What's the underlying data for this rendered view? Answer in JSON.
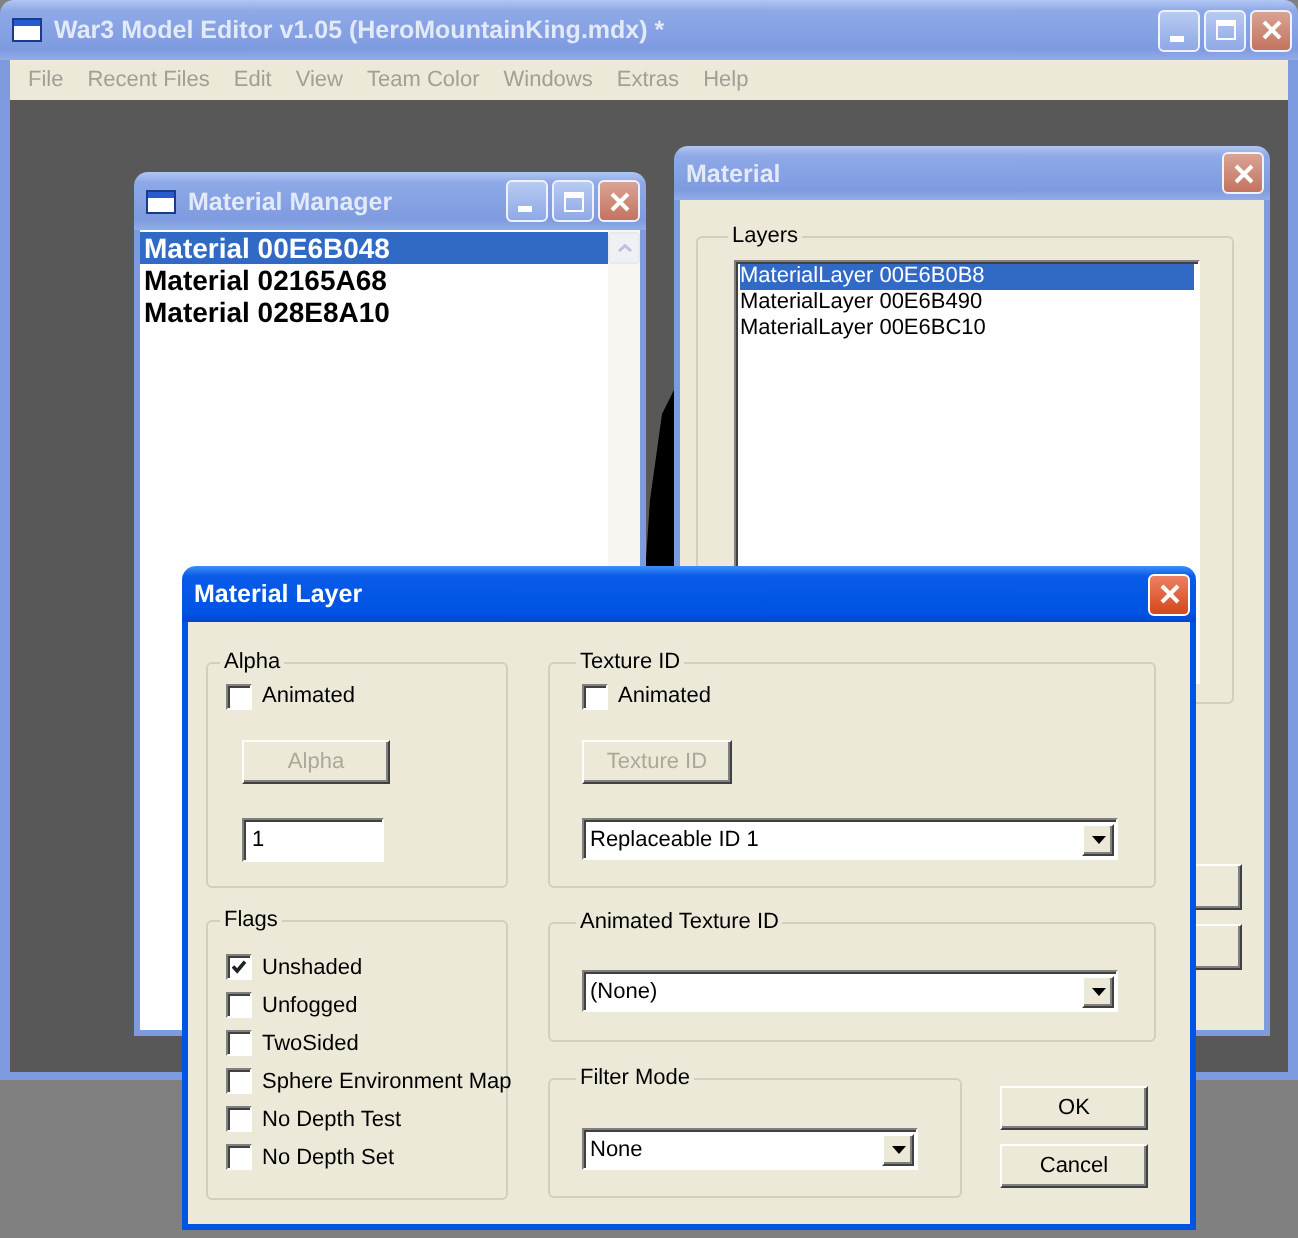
{
  "main_window": {
    "title": "War3 Model Editor v1.05 (HeroMountainKing.mdx) *",
    "active": false,
    "menu": [
      {
        "label": "File",
        "disabled": true
      },
      {
        "label": "Recent Files",
        "disabled": true
      },
      {
        "label": "Edit",
        "disabled": true
      },
      {
        "label": "View",
        "disabled": true
      },
      {
        "label": "Team Color",
        "disabled": true
      },
      {
        "label": "Windows",
        "disabled": true
      },
      {
        "label": "Extras",
        "disabled": true
      },
      {
        "label": "Help",
        "disabled": true
      }
    ]
  },
  "material_manager": {
    "title": "Material Manager",
    "active": false,
    "items": [
      {
        "label": "Material 00E6B048",
        "selected": true
      },
      {
        "label": "Material 02165A68",
        "selected": false
      },
      {
        "label": "Material 028E8A10",
        "selected": false
      }
    ]
  },
  "material_window": {
    "title": "Material",
    "active": false,
    "layers_group": {
      "title": "Layers",
      "items": [
        {
          "label": "MaterialLayer 00E6B0B8",
          "selected": true
        },
        {
          "label": "MaterialLayer 00E6B490",
          "selected": false
        },
        {
          "label": "MaterialLayer 00E6BC10",
          "selected": false
        }
      ]
    }
  },
  "material_layer_dialog": {
    "title": "Material Layer",
    "active": true,
    "alpha": {
      "title": "Alpha",
      "animated": {
        "label": "Animated",
        "checked": false
      },
      "button": {
        "label": "Alpha",
        "disabled": true
      },
      "value": "1"
    },
    "texture_id": {
      "title": "Texture ID",
      "animated": {
        "label": "Animated",
        "checked": false
      },
      "button": {
        "label": "Texture ID",
        "disabled": true
      },
      "selection": "Replaceable ID 1"
    },
    "flags": {
      "title": "Flags",
      "items": [
        {
          "label": "Unshaded",
          "checked": true
        },
        {
          "label": "Unfogged",
          "checked": false
        },
        {
          "label": "TwoSided",
          "checked": false
        },
        {
          "label": "Sphere Environment Map",
          "checked": false
        },
        {
          "label": "No Depth Test",
          "checked": false
        },
        {
          "label": "No Depth Set",
          "checked": false
        }
      ]
    },
    "animated_texture_id": {
      "title": "Animated Texture ID",
      "selection": "(None)"
    },
    "filter_mode": {
      "title": "Filter Mode",
      "selection": "None"
    },
    "buttons": [
      "OK",
      "Cancel"
    ]
  }
}
